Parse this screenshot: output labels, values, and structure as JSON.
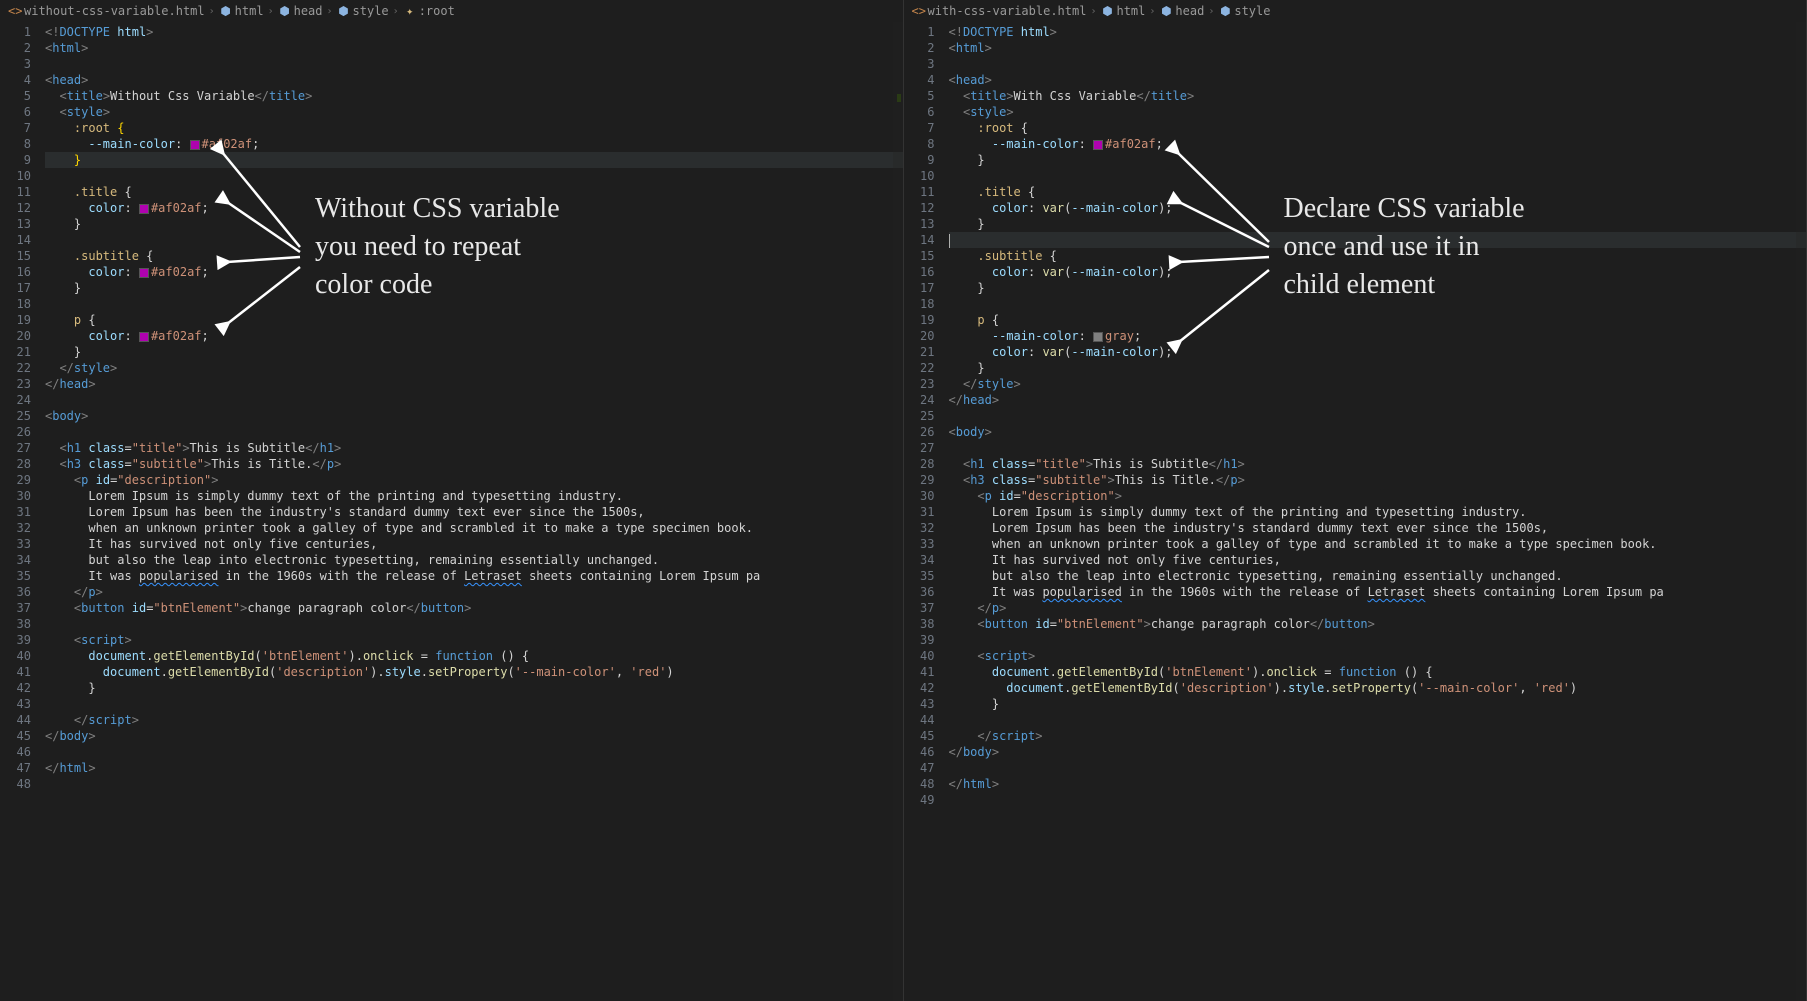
{
  "left": {
    "breadcrumb": {
      "file": "without-css-variable.html",
      "parts": [
        "html",
        "head",
        "style",
        ":root"
      ]
    },
    "annotation": "Without CSS variable\nyou need to repeat\ncolor code",
    "code_lines": [
      {
        "n": 1,
        "html": "<span class='tok-bracket'>&lt;!</span><span class='tok-tag'>DOCTYPE</span> <span class='tok-attr'>html</span><span class='tok-bracket'>&gt;</span>"
      },
      {
        "n": 2,
        "html": "<span class='tok-bracket'>&lt;</span><span class='tok-tag'>html</span><span class='tok-bracket'>&gt;</span>"
      },
      {
        "n": 3,
        "html": ""
      },
      {
        "n": 4,
        "html": "<span class='tok-bracket'>&lt;</span><span class='tok-tag'>head</span><span class='tok-bracket'>&gt;</span>"
      },
      {
        "n": 5,
        "html": "  <span class='tok-bracket'>&lt;</span><span class='tok-tag'>title</span><span class='tok-bracket'>&gt;</span><span class='tok-text'>Without Css Variable</span><span class='tok-bracket'>&lt;/</span><span class='tok-tag'>title</span><span class='tok-bracket'>&gt;</span>"
      },
      {
        "n": 6,
        "html": "  <span class='tok-bracket'>&lt;</span><span class='tok-tag'>style</span><span class='tok-bracket'>&gt;</span>"
      },
      {
        "n": 7,
        "html": "    <span class='tok-sel'>:root</span> <span class='tok-brace'>{</span>"
      },
      {
        "n": 8,
        "html": "      <span class='tok-prop'>--main-color</span><span class='tok-punct'>:</span> <span class='swatch sw-magenta'></span><span class='tok-val'>#af02af</span><span class='tok-punct'>;</span>"
      },
      {
        "n": 9,
        "html": "    <span class='tok-brace'>}</span>",
        "hl": true
      },
      {
        "n": 10,
        "html": ""
      },
      {
        "n": 11,
        "html": "    <span class='tok-sel'>.title</span> <span class='tok-punct'>{</span>"
      },
      {
        "n": 12,
        "html": "      <span class='tok-prop'>color</span><span class='tok-punct'>:</span> <span class='swatch sw-magenta'></span><span class='tok-val'>#af02af</span><span class='tok-punct'>;</span>"
      },
      {
        "n": 13,
        "html": "    <span class='tok-punct'>}</span>"
      },
      {
        "n": 14,
        "html": ""
      },
      {
        "n": 15,
        "html": "    <span class='tok-sel'>.subtitle</span> <span class='tok-punct'>{</span>"
      },
      {
        "n": 16,
        "html": "      <span class='tok-prop'>color</span><span class='tok-punct'>:</span> <span class='swatch sw-magenta'></span><span class='tok-val'>#af02af</span><span class='tok-punct'>;</span>"
      },
      {
        "n": 17,
        "html": "    <span class='tok-punct'>}</span>"
      },
      {
        "n": 18,
        "html": ""
      },
      {
        "n": 19,
        "html": "    <span class='tok-sel'>p</span> <span class='tok-punct'>{</span>"
      },
      {
        "n": 20,
        "html": "      <span class='tok-prop'>color</span><span class='tok-punct'>:</span> <span class='swatch sw-magenta'></span><span class='tok-val'>#af02af</span><span class='tok-punct'>;</span>"
      },
      {
        "n": 21,
        "html": "    <span class='tok-punct'>}</span>"
      },
      {
        "n": 22,
        "html": "  <span class='tok-bracket'>&lt;/</span><span class='tok-tag'>style</span><span class='tok-bracket'>&gt;</span>"
      },
      {
        "n": 23,
        "html": "<span class='tok-bracket'>&lt;/</span><span class='tok-tag'>head</span><span class='tok-bracket'>&gt;</span>"
      },
      {
        "n": 24,
        "html": ""
      },
      {
        "n": 25,
        "html": "<span class='tok-bracket'>&lt;</span><span class='tok-tag'>body</span><span class='tok-bracket'>&gt;</span>"
      },
      {
        "n": 26,
        "html": ""
      },
      {
        "n": 27,
        "html": "  <span class='tok-bracket'>&lt;</span><span class='tok-tag'>h1</span> <span class='tok-attr'>class</span>=<span class='tok-str'>\"title\"</span><span class='tok-bracket'>&gt;</span><span class='tok-text'>This is Subtitle</span><span class='tok-bracket'>&lt;/</span><span class='tok-tag'>h1</span><span class='tok-bracket'>&gt;</span>"
      },
      {
        "n": 28,
        "html": "  <span class='tok-bracket'>&lt;</span><span class='tok-tag'>h3</span> <span class='tok-attr'>class</span>=<span class='tok-str'>\"subtitle\"</span><span class='tok-bracket'>&gt;</span><span class='tok-text'>This is Title.</span><span class='tok-bracket'>&lt;/</span><span class='tok-tag'>p</span><span class='tok-bracket'>&gt;</span>"
      },
      {
        "n": 29,
        "html": "    <span class='tok-bracket'>&lt;</span><span class='tok-tag'>p</span> <span class='tok-attr'>id</span>=<span class='tok-str'>\"description\"</span><span class='tok-bracket'>&gt;</span>"
      },
      {
        "n": 30,
        "html": "      <span class='tok-text'>Lorem Ipsum is simply dummy text of the printing and typesetting industry.</span>"
      },
      {
        "n": 31,
        "html": "      <span class='tok-text'>Lorem Ipsum has been the industry's standard dummy text ever since the 1500s,</span>"
      },
      {
        "n": 32,
        "html": "      <span class='tok-text'>when an unknown printer took a galley of type and scrambled it to make a type specimen book.</span>"
      },
      {
        "n": 33,
        "html": "      <span class='tok-text'>It has survived not only five centuries,</span>"
      },
      {
        "n": 34,
        "html": "      <span class='tok-text'>but also the leap into electronic typesetting, remaining essentially unchanged.</span>"
      },
      {
        "n": 35,
        "html": "      <span class='tok-text'>It was <span class='tok-squiggle'>popularised</span> in the 1960s with the release of <span class='tok-squiggle'>Letraset</span> sheets containing Lorem Ipsum pa</span>"
      },
      {
        "n": 36,
        "html": "    <span class='tok-bracket'>&lt;/</span><span class='tok-tag'>p</span><span class='tok-bracket'>&gt;</span>"
      },
      {
        "n": 37,
        "html": "    <span class='tok-bracket'>&lt;</span><span class='tok-tag'>button</span> <span class='tok-attr'>id</span>=<span class='tok-str'>\"btnElement\"</span><span class='tok-bracket'>&gt;</span><span class='tok-text'>change paragraph color</span><span class='tok-bracket'>&lt;/</span><span class='tok-tag'>button</span><span class='tok-bracket'>&gt;</span>"
      },
      {
        "n": 38,
        "html": ""
      },
      {
        "n": 39,
        "html": "    <span class='tok-bracket'>&lt;</span><span class='tok-tag'>script</span><span class='tok-bracket'>&gt;</span>"
      },
      {
        "n": 40,
        "html": "      <span class='tok-obj'>document</span><span class='tok-punct'>.</span><span class='tok-fn'>getElementById</span><span class='tok-punct'>(</span><span class='tok-str'>'btnElement'</span><span class='tok-punct'>).</span><span class='tok-fn'>onclick</span> <span class='tok-punct'>=</span> <span class='tok-kw'>function</span> <span class='tok-punct'>() {</span>"
      },
      {
        "n": 41,
        "html": "        <span class='tok-obj'>document</span><span class='tok-punct'>.</span><span class='tok-fn'>getElementById</span><span class='tok-punct'>(</span><span class='tok-str'>'description'</span><span class='tok-punct'>).</span><span class='tok-obj'>style</span><span class='tok-punct'>.</span><span class='tok-fn'>setProperty</span><span class='tok-punct'>(</span><span class='tok-str'>'--main-color'</span><span class='tok-punct'>,</span> <span class='tok-str'>'red'</span><span class='tok-punct'>)</span>"
      },
      {
        "n": 42,
        "html": "      <span class='tok-punct'>}</span>"
      },
      {
        "n": 43,
        "html": ""
      },
      {
        "n": 44,
        "html": "    <span class='tok-bracket'>&lt;/</span><span class='tok-tag'>script</span><span class='tok-bracket'>&gt;</span>"
      },
      {
        "n": 45,
        "html": "<span class='tok-bracket'>&lt;/</span><span class='tok-tag'>body</span><span class='tok-bracket'>&gt;</span>"
      },
      {
        "n": 46,
        "html": ""
      },
      {
        "n": 47,
        "html": "<span class='tok-bracket'>&lt;/</span><span class='tok-tag'>html</span><span class='tok-bracket'>&gt;</span>"
      },
      {
        "n": 48,
        "html": ""
      }
    ]
  },
  "right": {
    "breadcrumb": {
      "file": "with-css-variable.html",
      "parts": [
        "html",
        "head",
        "style"
      ]
    },
    "annotation": "Declare CSS variable\nonce and use it in\nchild element",
    "code_lines": [
      {
        "n": 1,
        "html": "<span class='tok-bracket'>&lt;!</span><span class='tok-tag'>DOCTYPE</span> <span class='tok-attr'>html</span><span class='tok-bracket'>&gt;</span>"
      },
      {
        "n": 2,
        "html": "<span class='tok-bracket'>&lt;</span><span class='tok-tag'>html</span><span class='tok-bracket'>&gt;</span>"
      },
      {
        "n": 3,
        "html": ""
      },
      {
        "n": 4,
        "html": "<span class='tok-bracket'>&lt;</span><span class='tok-tag'>head</span><span class='tok-bracket'>&gt;</span>"
      },
      {
        "n": 5,
        "html": "  <span class='tok-bracket'>&lt;</span><span class='tok-tag'>title</span><span class='tok-bracket'>&gt;</span><span class='tok-text'>With Css Variable</span><span class='tok-bracket'>&lt;/</span><span class='tok-tag'>title</span><span class='tok-bracket'>&gt;</span>"
      },
      {
        "n": 6,
        "html": "  <span class='tok-bracket'>&lt;</span><span class='tok-tag'>style</span><span class='tok-bracket'>&gt;</span>"
      },
      {
        "n": 7,
        "html": "    <span class='tok-sel'>:root</span> <span class='tok-punct'>{</span>"
      },
      {
        "n": 8,
        "html": "      <span class='tok-prop'>--main-color</span><span class='tok-punct'>:</span> <span class='swatch sw-magenta'></span><span class='tok-val'>#af02af</span><span class='tok-punct'>;</span>"
      },
      {
        "n": 9,
        "html": "    <span class='tok-punct'>}</span>"
      },
      {
        "n": 10,
        "html": ""
      },
      {
        "n": 11,
        "html": "    <span class='tok-sel'>.title</span> <span class='tok-punct'>{</span>"
      },
      {
        "n": 12,
        "html": "      <span class='tok-prop'>color</span><span class='tok-punct'>:</span> <span class='tok-fn'>var</span><span class='tok-punct'>(</span><span class='tok-prop'>--main-color</span><span class='tok-punct'>);</span>"
      },
      {
        "n": 13,
        "html": "    <span class='tok-punct'>}</span>"
      },
      {
        "n": 14,
        "html": "<span class='cursor'></span>",
        "hl": true
      },
      {
        "n": 15,
        "html": "    <span class='tok-sel'>.subtitle</span> <span class='tok-punct'>{</span>"
      },
      {
        "n": 16,
        "html": "      <span class='tok-prop'>color</span><span class='tok-punct'>:</span> <span class='tok-fn'>var</span><span class='tok-punct'>(</span><span class='tok-prop'>--main-color</span><span class='tok-punct'>);</span>"
      },
      {
        "n": 17,
        "html": "    <span class='tok-punct'>}</span>"
      },
      {
        "n": 18,
        "html": ""
      },
      {
        "n": 19,
        "html": "    <span class='tok-sel'>p</span> <span class='tok-punct'>{</span>"
      },
      {
        "n": 20,
        "html": "      <span class='tok-prop'>--main-color</span><span class='tok-punct'>:</span> <span class='swatch sw-gray'></span><span class='tok-val'>gray</span><span class='tok-punct'>;</span>"
      },
      {
        "n": 21,
        "html": "      <span class='tok-prop'>color</span><span class='tok-punct'>:</span> <span class='tok-fn'>var</span><span class='tok-punct'>(</span><span class='tok-prop'>--main-color</span><span class='tok-punct'>);</span>"
      },
      {
        "n": 22,
        "html": "    <span class='tok-punct'>}</span>"
      },
      {
        "n": 23,
        "html": "  <span class='tok-bracket'>&lt;/</span><span class='tok-tag'>style</span><span class='tok-bracket'>&gt;</span>"
      },
      {
        "n": 24,
        "html": "<span class='tok-bracket'>&lt;/</span><span class='tok-tag'>head</span><span class='tok-bracket'>&gt;</span>"
      },
      {
        "n": 25,
        "html": ""
      },
      {
        "n": 26,
        "html": "<span class='tok-bracket'>&lt;</span><span class='tok-tag'>body</span><span class='tok-bracket'>&gt;</span>"
      },
      {
        "n": 27,
        "html": ""
      },
      {
        "n": 28,
        "html": "  <span class='tok-bracket'>&lt;</span><span class='tok-tag'>h1</span> <span class='tok-attr'>class</span>=<span class='tok-str'>\"title\"</span><span class='tok-bracket'>&gt;</span><span class='tok-text'>This is Subtitle</span><span class='tok-bracket'>&lt;/</span><span class='tok-tag'>h1</span><span class='tok-bracket'>&gt;</span>"
      },
      {
        "n": 29,
        "html": "  <span class='tok-bracket'>&lt;</span><span class='tok-tag'>h3</span> <span class='tok-attr'>class</span>=<span class='tok-str'>\"subtitle\"</span><span class='tok-bracket'>&gt;</span><span class='tok-text'>This is Title.</span><span class='tok-bracket'>&lt;/</span><span class='tok-tag'>p</span><span class='tok-bracket'>&gt;</span>"
      },
      {
        "n": 30,
        "html": "    <span class='tok-bracket'>&lt;</span><span class='tok-tag'>p</span> <span class='tok-attr'>id</span>=<span class='tok-str'>\"description\"</span><span class='tok-bracket'>&gt;</span>"
      },
      {
        "n": 31,
        "html": "      <span class='tok-text'>Lorem Ipsum is simply dummy text of the printing and typesetting industry.</span>"
      },
      {
        "n": 32,
        "html": "      <span class='tok-text'>Lorem Ipsum has been the industry's standard dummy text ever since the 1500s,</span>"
      },
      {
        "n": 33,
        "html": "      <span class='tok-text'>when an unknown printer took a galley of type and scrambled it to make a type specimen book.</span>"
      },
      {
        "n": 34,
        "html": "      <span class='tok-text'>It has survived not only five centuries,</span>"
      },
      {
        "n": 35,
        "html": "      <span class='tok-text'>but also the leap into electronic typesetting, remaining essentially unchanged.</span>"
      },
      {
        "n": 36,
        "html": "      <span class='tok-text'>It was <span class='tok-squiggle'>popularised</span> in the 1960s with the release of <span class='tok-squiggle'>Letraset</span> sheets containing Lorem Ipsum pa</span>"
      },
      {
        "n": 37,
        "html": "    <span class='tok-bracket'>&lt;/</span><span class='tok-tag'>p</span><span class='tok-bracket'>&gt;</span>"
      },
      {
        "n": 38,
        "html": "    <span class='tok-bracket'>&lt;</span><span class='tok-tag'>button</span> <span class='tok-attr'>id</span>=<span class='tok-str'>\"btnElement\"</span><span class='tok-bracket'>&gt;</span><span class='tok-text'>change paragraph color</span><span class='tok-bracket'>&lt;/</span><span class='tok-tag'>button</span><span class='tok-bracket'>&gt;</span>"
      },
      {
        "n": 39,
        "html": ""
      },
      {
        "n": 40,
        "html": "    <span class='tok-bracket'>&lt;</span><span class='tok-tag'>script</span><span class='tok-bracket'>&gt;</span>"
      },
      {
        "n": 41,
        "html": "      <span class='tok-obj'>document</span><span class='tok-punct'>.</span><span class='tok-fn'>getElementById</span><span class='tok-punct'>(</span><span class='tok-str'>'btnElement'</span><span class='tok-punct'>).</span><span class='tok-fn'>onclick</span> <span class='tok-punct'>=</span> <span class='tok-kw'>function</span> <span class='tok-punct'>() {</span>"
      },
      {
        "n": 42,
        "html": "        <span class='tok-obj'>document</span><span class='tok-punct'>.</span><span class='tok-fn'>getElementById</span><span class='tok-punct'>(</span><span class='tok-str'>'description'</span><span class='tok-punct'>).</span><span class='tok-obj'>style</span><span class='tok-punct'>.</span><span class='tok-fn'>setProperty</span><span class='tok-punct'>(</span><span class='tok-str'>'--main-color'</span><span class='tok-punct'>,</span> <span class='tok-str'>'red'</span><span class='tok-punct'>)</span>"
      },
      {
        "n": 43,
        "html": "      <span class='tok-punct'>}</span>"
      },
      {
        "n": 44,
        "html": ""
      },
      {
        "n": 45,
        "html": "    <span class='tok-bracket'>&lt;/</span><span class='tok-tag'>script</span><span class='tok-bracket'>&gt;</span>"
      },
      {
        "n": 46,
        "html": "<span class='tok-bracket'>&lt;/</span><span class='tok-tag'>body</span><span class='tok-bracket'>&gt;</span>"
      },
      {
        "n": 47,
        "html": ""
      },
      {
        "n": 48,
        "html": "<span class='tok-bracket'>&lt;/</span><span class='tok-tag'>html</span><span class='tok-bracket'>&gt;</span>"
      },
      {
        "n": 49,
        "html": ""
      }
    ]
  }
}
